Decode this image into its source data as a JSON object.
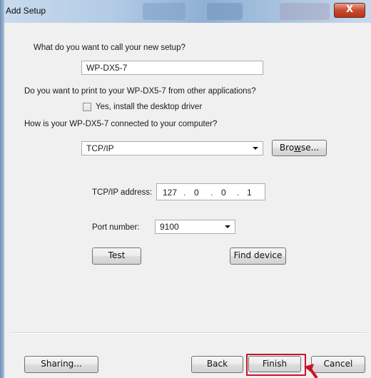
{
  "window": {
    "title": "Add Setup",
    "close_glyph": "X"
  },
  "form": {
    "name_question": "What do you want to call your new setup?",
    "name_value": "WP-DX5-7",
    "print_question": "Do you want to print to your WP-DX5-7 from other applications?",
    "driver_checkbox_label": "Yes, install the desktop driver",
    "driver_checked": false,
    "connection_question": "How is your WP-DX5-7 connected to your computer?",
    "connection_selected": "TCP/IP",
    "browse_label_pre": "Bro",
    "browse_label_mnemonic": "w",
    "browse_label_post": "se..."
  },
  "tcpip": {
    "address_label": "TCP/IP address:",
    "octets": [
      "127",
      "0",
      "0",
      "1"
    ],
    "port_label": "Port number:",
    "port_selected": "9100",
    "test_label": "Test",
    "find_device_label": "Find device"
  },
  "footer": {
    "sharing_label": "Sharing...",
    "back_label": "Back",
    "finish_label": "Finish",
    "cancel_label": "Cancel"
  },
  "colors": {
    "highlight": "#c8142a"
  },
  "icons": {
    "close": "close-icon",
    "dropdown": "chevron-down-icon",
    "pointer": "arrow-pointer-icon"
  }
}
